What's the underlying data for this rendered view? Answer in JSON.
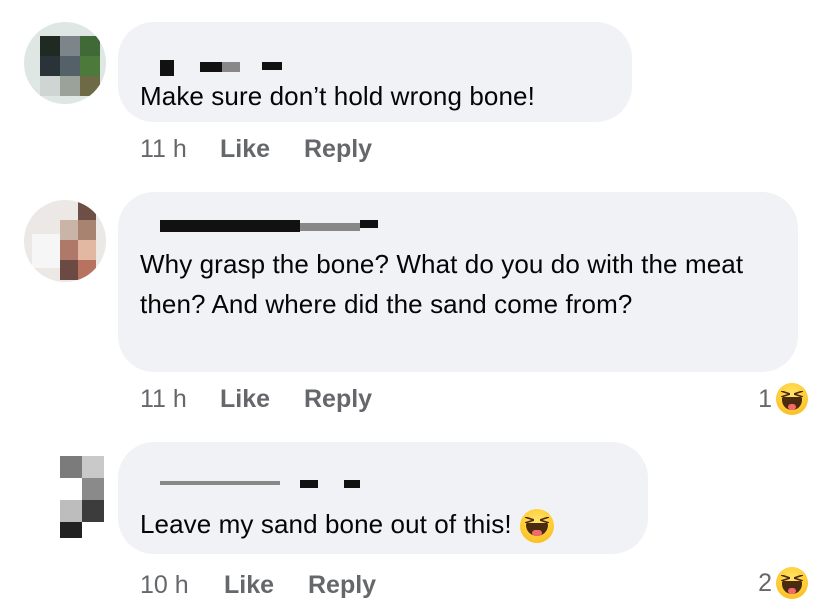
{
  "comments": [
    {
      "text": "Make sure don’t hold wrong bone!",
      "time": "11 h",
      "like_label": "Like",
      "reply_label": "Reply"
    },
    {
      "text": "Why grasp the bone? What do you do with the meat then? And where did the sand come from?",
      "time": "11 h",
      "like_label": "Like",
      "reply_label": "Reply",
      "reaction_count": "1",
      "reaction_icon": "laughing-emoji-icon"
    },
    {
      "text": "Leave my sand bone out of this!",
      "inline_emoji": "laughing-emoji-icon",
      "time": "10 h",
      "like_label": "Like",
      "reply_label": "Reply",
      "reaction_count": "2",
      "reaction_icon": "laughing-emoji-icon"
    }
  ],
  "colors": {
    "bubble": "#f0f2f5",
    "text": "#050505",
    "meta": "#65676b",
    "emoji": "#ffcc33"
  }
}
